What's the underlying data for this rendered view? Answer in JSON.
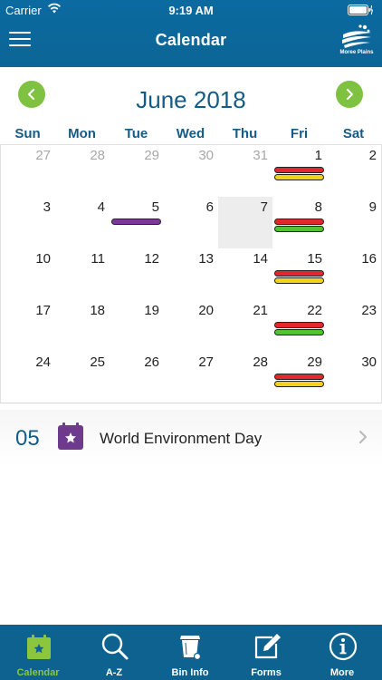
{
  "status_bar": {
    "carrier": "Carrier",
    "time": "9:19 AM"
  },
  "header": {
    "title": "Calendar",
    "logo_text": "Moree Plains"
  },
  "calendar": {
    "month_title": "June 2018",
    "weekdays": [
      "Sun",
      "Mon",
      "Tue",
      "Wed",
      "Thu",
      "Fri",
      "Sat"
    ],
    "weeks": [
      [
        {
          "day": "27",
          "muted": true,
          "bars": []
        },
        {
          "day": "28",
          "muted": true,
          "bars": []
        },
        {
          "day": "29",
          "muted": true,
          "bars": []
        },
        {
          "day": "30",
          "muted": true,
          "bars": []
        },
        {
          "day": "31",
          "muted": true,
          "bars": []
        },
        {
          "day": "1",
          "muted": false,
          "bars": [
            "red",
            "yellow"
          ]
        },
        {
          "day": "2",
          "muted": false,
          "bars": []
        }
      ],
      [
        {
          "day": "3",
          "muted": false,
          "bars": []
        },
        {
          "day": "4",
          "muted": false,
          "bars": []
        },
        {
          "day": "5",
          "muted": false,
          "bars": [
            "purple"
          ]
        },
        {
          "day": "6",
          "muted": false,
          "bars": []
        },
        {
          "day": "7",
          "muted": false,
          "bars": [],
          "selected": true
        },
        {
          "day": "8",
          "muted": false,
          "bars": [
            "red",
            "green"
          ]
        },
        {
          "day": "9",
          "muted": false,
          "bars": []
        }
      ],
      [
        {
          "day": "10",
          "muted": false,
          "bars": []
        },
        {
          "day": "11",
          "muted": false,
          "bars": []
        },
        {
          "day": "12",
          "muted": false,
          "bars": []
        },
        {
          "day": "13",
          "muted": false,
          "bars": []
        },
        {
          "day": "14",
          "muted": false,
          "bars": []
        },
        {
          "day": "15",
          "muted": false,
          "bars": [
            "red",
            "yellow"
          ]
        },
        {
          "day": "16",
          "muted": false,
          "bars": []
        }
      ],
      [
        {
          "day": "17",
          "muted": false,
          "bars": []
        },
        {
          "day": "18",
          "muted": false,
          "bars": []
        },
        {
          "day": "19",
          "muted": false,
          "bars": []
        },
        {
          "day": "20",
          "muted": false,
          "bars": []
        },
        {
          "day": "21",
          "muted": false,
          "bars": []
        },
        {
          "day": "22",
          "muted": false,
          "bars": [
            "red",
            "green"
          ]
        },
        {
          "day": "23",
          "muted": false,
          "bars": []
        }
      ],
      [
        {
          "day": "24",
          "muted": false,
          "bars": []
        },
        {
          "day": "25",
          "muted": false,
          "bars": []
        },
        {
          "day": "26",
          "muted": false,
          "bars": []
        },
        {
          "day": "27",
          "muted": false,
          "bars": []
        },
        {
          "day": "28",
          "muted": false,
          "bars": []
        },
        {
          "day": "29",
          "muted": false,
          "bars": [
            "red",
            "yellow"
          ]
        },
        {
          "day": "30",
          "muted": false,
          "bars": []
        }
      ]
    ]
  },
  "event": {
    "day": "05",
    "title": "World Environment Day",
    "icon": "star-calendar-icon"
  },
  "tabs": [
    {
      "label": "Calendar",
      "icon": "calendar-star-icon",
      "active": true
    },
    {
      "label": "A-Z",
      "icon": "search-icon",
      "active": false
    },
    {
      "label": "Bin Info",
      "icon": "bin-icon",
      "active": false
    },
    {
      "label": "Forms",
      "icon": "edit-icon",
      "active": false
    },
    {
      "label": "More",
      "icon": "info-icon",
      "active": false
    }
  ],
  "colors": {
    "header": "#0c6596",
    "accent_green": "#7fc241",
    "title_blue": "#145c86",
    "bar_red": "#e2272d",
    "bar_yellow": "#f5d21a",
    "bar_green": "#52c230",
    "bar_purple": "#7b3a9a",
    "event_purple": "#6e3a8e"
  }
}
